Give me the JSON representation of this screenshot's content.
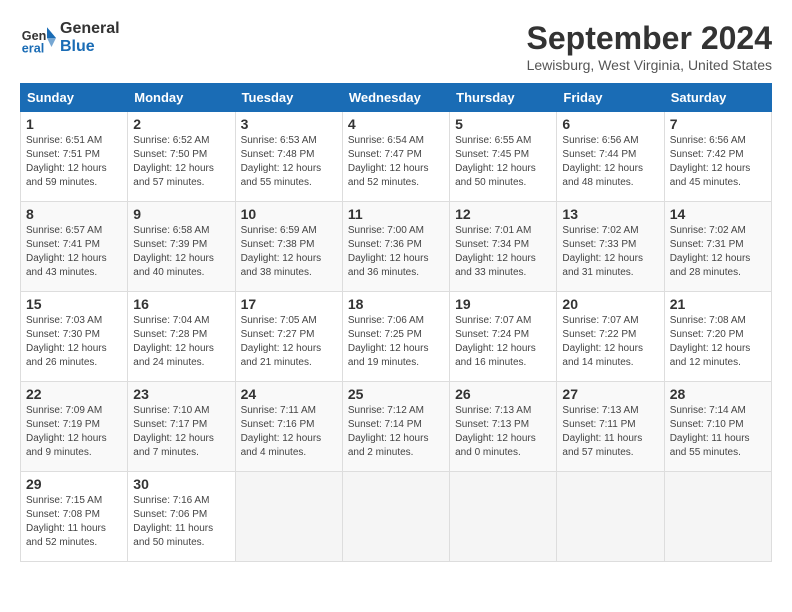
{
  "logo": {
    "line1": "General",
    "line2": "Blue"
  },
  "title": "September 2024",
  "location": "Lewisburg, West Virginia, United States",
  "days_of_week": [
    "Sunday",
    "Monday",
    "Tuesday",
    "Wednesday",
    "Thursday",
    "Friday",
    "Saturday"
  ],
  "weeks": [
    [
      {
        "day": "1",
        "info": "Sunrise: 6:51 AM\nSunset: 7:51 PM\nDaylight: 12 hours\nand 59 minutes."
      },
      {
        "day": "2",
        "info": "Sunrise: 6:52 AM\nSunset: 7:50 PM\nDaylight: 12 hours\nand 57 minutes."
      },
      {
        "day": "3",
        "info": "Sunrise: 6:53 AM\nSunset: 7:48 PM\nDaylight: 12 hours\nand 55 minutes."
      },
      {
        "day": "4",
        "info": "Sunrise: 6:54 AM\nSunset: 7:47 PM\nDaylight: 12 hours\nand 52 minutes."
      },
      {
        "day": "5",
        "info": "Sunrise: 6:55 AM\nSunset: 7:45 PM\nDaylight: 12 hours\nand 50 minutes."
      },
      {
        "day": "6",
        "info": "Sunrise: 6:56 AM\nSunset: 7:44 PM\nDaylight: 12 hours\nand 48 minutes."
      },
      {
        "day": "7",
        "info": "Sunrise: 6:56 AM\nSunset: 7:42 PM\nDaylight: 12 hours\nand 45 minutes."
      }
    ],
    [
      {
        "day": "8",
        "info": "Sunrise: 6:57 AM\nSunset: 7:41 PM\nDaylight: 12 hours\nand 43 minutes."
      },
      {
        "day": "9",
        "info": "Sunrise: 6:58 AM\nSunset: 7:39 PM\nDaylight: 12 hours\nand 40 minutes."
      },
      {
        "day": "10",
        "info": "Sunrise: 6:59 AM\nSunset: 7:38 PM\nDaylight: 12 hours\nand 38 minutes."
      },
      {
        "day": "11",
        "info": "Sunrise: 7:00 AM\nSunset: 7:36 PM\nDaylight: 12 hours\nand 36 minutes."
      },
      {
        "day": "12",
        "info": "Sunrise: 7:01 AM\nSunset: 7:34 PM\nDaylight: 12 hours\nand 33 minutes."
      },
      {
        "day": "13",
        "info": "Sunrise: 7:02 AM\nSunset: 7:33 PM\nDaylight: 12 hours\nand 31 minutes."
      },
      {
        "day": "14",
        "info": "Sunrise: 7:02 AM\nSunset: 7:31 PM\nDaylight: 12 hours\nand 28 minutes."
      }
    ],
    [
      {
        "day": "15",
        "info": "Sunrise: 7:03 AM\nSunset: 7:30 PM\nDaylight: 12 hours\nand 26 minutes."
      },
      {
        "day": "16",
        "info": "Sunrise: 7:04 AM\nSunset: 7:28 PM\nDaylight: 12 hours\nand 24 minutes."
      },
      {
        "day": "17",
        "info": "Sunrise: 7:05 AM\nSunset: 7:27 PM\nDaylight: 12 hours\nand 21 minutes."
      },
      {
        "day": "18",
        "info": "Sunrise: 7:06 AM\nSunset: 7:25 PM\nDaylight: 12 hours\nand 19 minutes."
      },
      {
        "day": "19",
        "info": "Sunrise: 7:07 AM\nSunset: 7:24 PM\nDaylight: 12 hours\nand 16 minutes."
      },
      {
        "day": "20",
        "info": "Sunrise: 7:07 AM\nSunset: 7:22 PM\nDaylight: 12 hours\nand 14 minutes."
      },
      {
        "day": "21",
        "info": "Sunrise: 7:08 AM\nSunset: 7:20 PM\nDaylight: 12 hours\nand 12 minutes."
      }
    ],
    [
      {
        "day": "22",
        "info": "Sunrise: 7:09 AM\nSunset: 7:19 PM\nDaylight: 12 hours\nand 9 minutes."
      },
      {
        "day": "23",
        "info": "Sunrise: 7:10 AM\nSunset: 7:17 PM\nDaylight: 12 hours\nand 7 minutes."
      },
      {
        "day": "24",
        "info": "Sunrise: 7:11 AM\nSunset: 7:16 PM\nDaylight: 12 hours\nand 4 minutes."
      },
      {
        "day": "25",
        "info": "Sunrise: 7:12 AM\nSunset: 7:14 PM\nDaylight: 12 hours\nand 2 minutes."
      },
      {
        "day": "26",
        "info": "Sunrise: 7:13 AM\nSunset: 7:13 PM\nDaylight: 12 hours\nand 0 minutes."
      },
      {
        "day": "27",
        "info": "Sunrise: 7:13 AM\nSunset: 7:11 PM\nDaylight: 11 hours\nand 57 minutes."
      },
      {
        "day": "28",
        "info": "Sunrise: 7:14 AM\nSunset: 7:10 PM\nDaylight: 11 hours\nand 55 minutes."
      }
    ],
    [
      {
        "day": "29",
        "info": "Sunrise: 7:15 AM\nSunset: 7:08 PM\nDaylight: 11 hours\nand 52 minutes."
      },
      {
        "day": "30",
        "info": "Sunrise: 7:16 AM\nSunset: 7:06 PM\nDaylight: 11 hours\nand 50 minutes."
      },
      {
        "day": "",
        "info": ""
      },
      {
        "day": "",
        "info": ""
      },
      {
        "day": "",
        "info": ""
      },
      {
        "day": "",
        "info": ""
      },
      {
        "day": "",
        "info": ""
      }
    ]
  ]
}
